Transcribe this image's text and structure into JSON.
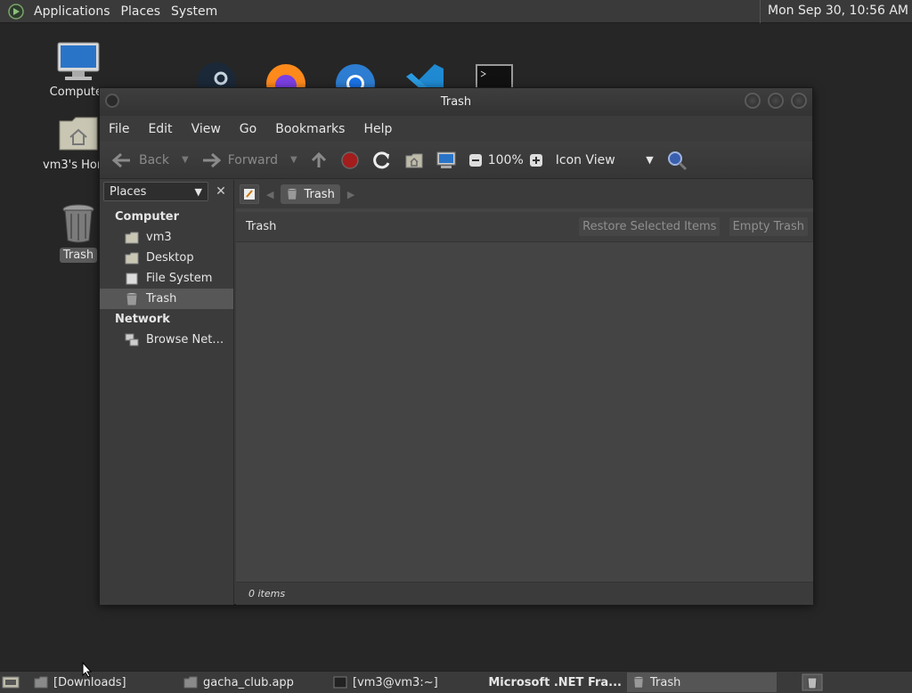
{
  "top_panel": {
    "menus": [
      "Applications",
      "Places",
      "System"
    ],
    "clock": "Mon Sep 30, 10:56 AM"
  },
  "desktop": {
    "icons": [
      {
        "label": "Computer"
      },
      {
        "label": "vm3's Home"
      },
      {
        "label": "Trash"
      }
    ]
  },
  "window": {
    "title": "Trash",
    "menubar": [
      "File",
      "Edit",
      "View",
      "Go",
      "Bookmarks",
      "Help"
    ],
    "toolbar": {
      "back": "Back",
      "forward": "Forward",
      "zoom": "100%",
      "view_mode": "Icon View"
    },
    "sidebar": {
      "selector": "Places",
      "sections": [
        {
          "title": "Computer",
          "items": [
            "vm3",
            "Desktop",
            "File System",
            "Trash"
          ]
        },
        {
          "title": "Network",
          "items": [
            "Browse Net…"
          ]
        }
      ],
      "selected": "Trash"
    },
    "location": {
      "crumb": "Trash"
    },
    "trash_bar": {
      "title": "Trash",
      "restore_label": "Restore Selected Items",
      "empty_label": "Empty Trash"
    },
    "status": "0 items"
  },
  "taskbar": {
    "tasks": [
      {
        "label": "[Downloads]"
      },
      {
        "label": "gacha_club.app"
      },
      {
        "label": "[vm3@vm3:~]"
      },
      {
        "label": "Microsoft .NET Fra..."
      },
      {
        "label": "Trash"
      }
    ]
  },
  "colors": {
    "panel": "#3a3a3a",
    "desktop": "#262626",
    "window": "#3b3b3b",
    "selection": "#575757"
  }
}
